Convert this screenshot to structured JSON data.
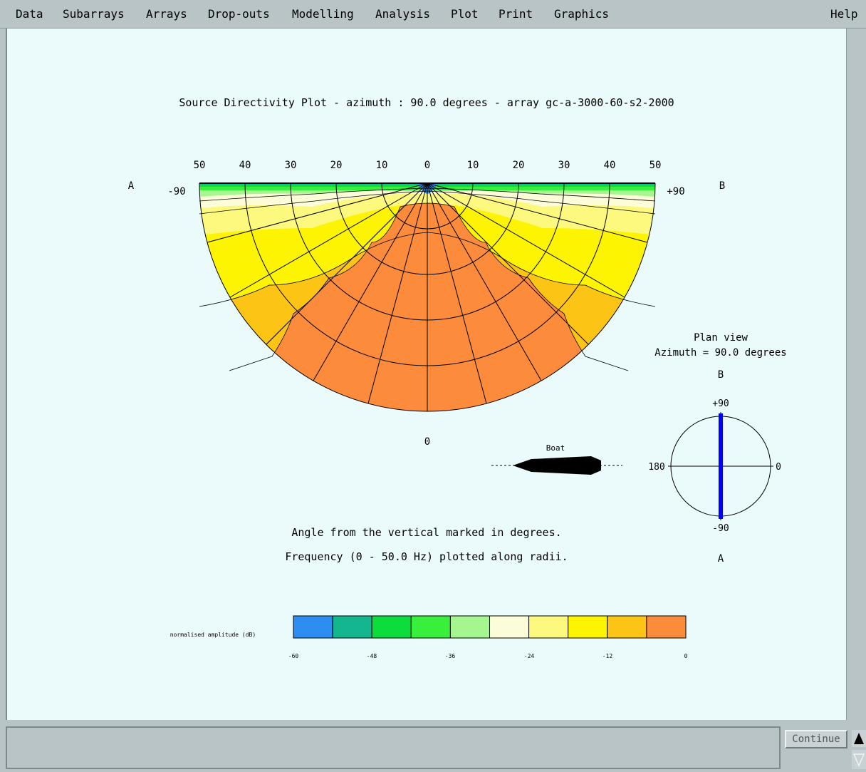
{
  "menu": {
    "items": [
      "Data",
      "Subarrays",
      "Arrays",
      "Drop-outs",
      "Modelling",
      "Analysis",
      "Plot",
      "Print",
      "Graphics"
    ],
    "help": "Help"
  },
  "plot": {
    "title": "Source Directivity Plot - azimuth : 90.0 degrees - array gc-a-3000-60-s2-2000",
    "frequency_ticks": [
      "50",
      "40",
      "30",
      "20",
      "10",
      "0",
      "10",
      "20",
      "30",
      "40",
      "50"
    ],
    "left_side_label": "A",
    "right_side_label": "B",
    "left_angle": "-90",
    "right_angle": "+90",
    "bottom_angle": "0",
    "caption_angle": "Angle from the vertical marked in degrees.",
    "caption_frequency": "Frequency (0 -  50.0 Hz) plotted along radii.",
    "boat_label": "Boat"
  },
  "plan_view": {
    "title": "Plan view",
    "azimuth_text": "Azimuth =  90.0 degrees",
    "top_label": "B",
    "bottom_label": "A",
    "tick_top": "+90",
    "tick_bottom": "-90",
    "tick_left": "180",
    "tick_right": "0",
    "azimuth_value": 90.0,
    "line_color": "#0000ff"
  },
  "colorbar": {
    "label": "normalised amplitude (dB)",
    "colors": [
      "#2b8ef0",
      "#14b690",
      "#0cdc3c",
      "#38f03c",
      "#a6f68e",
      "#fcfcd8",
      "#fdf87e",
      "#fcf400",
      "#fcc414",
      "#fc8c3c"
    ],
    "tick_labels": [
      "-60",
      "-48",
      "-36",
      "-24",
      "-12",
      "0"
    ]
  },
  "buttons": {
    "continue_label": "Continue"
  }
}
